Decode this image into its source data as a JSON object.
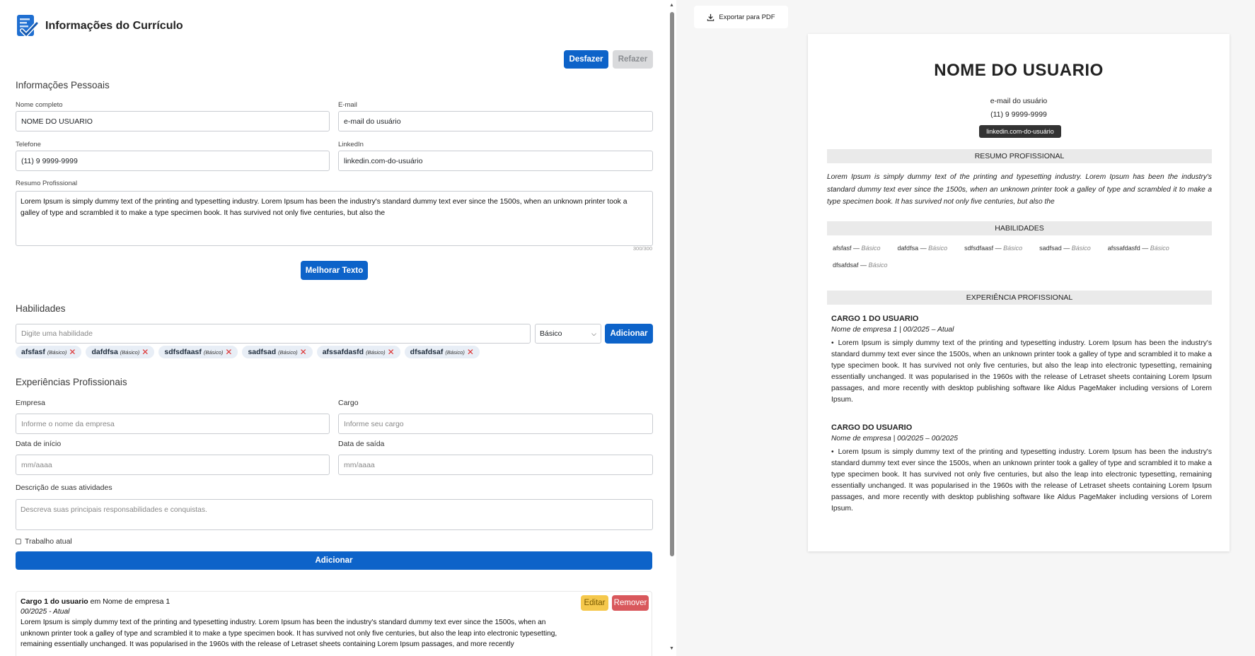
{
  "editor": {
    "title": "Informações do Currículo",
    "undo_label": "Desfazer",
    "redo_label": "Refazer",
    "personal": {
      "section_title": "Informações Pessoais",
      "name_label": "Nome completo",
      "name_value": "NOME DO USUARIO",
      "email_label": "E-mail",
      "email_value": "e-mail do usuário",
      "phone_label": "Telefone",
      "phone_value": "(11) 9 9999-9999",
      "linkedin_label": "LinkedIn",
      "linkedin_value": "linkedin.com-do-usuário",
      "summary_label": "Resumo Profissional",
      "summary_value": "Lorem Ipsum is simply dummy text of the printing and typesetting industry. Lorem Ipsum has been the industry's standard dummy text ever since the 1500s, when an unknown printer took a galley of type and scrambled it to make a type specimen book. It has survived not only five centuries, but also the",
      "summary_counter": "300/300",
      "improve_label": "Melhorar Texto"
    },
    "skills": {
      "section_title": "Habilidades",
      "input_placeholder": "Digite uma habilidade",
      "level_selected": "Básico",
      "add_label": "Adicionar",
      "items": [
        {
          "name": "afsfasf",
          "level": "(Básico)"
        },
        {
          "name": "dafdfsa",
          "level": "(Básico)"
        },
        {
          "name": "sdfsdfaasf",
          "level": "(Básico)"
        },
        {
          "name": "sadfsad",
          "level": "(Básico)"
        },
        {
          "name": "afssafdasfd",
          "level": "(Básico)"
        },
        {
          "name": "dfsafdsaf",
          "level": "(Básico)"
        }
      ]
    },
    "experience": {
      "section_title": "Experiências Profissionais",
      "company_label": "Empresa",
      "company_placeholder": "Informe o nome da empresa",
      "role_label": "Cargo",
      "role_placeholder": "Informe seu cargo",
      "start_label": "Data de início",
      "start_placeholder": "mm/aaaa",
      "end_label": "Data de saída",
      "end_placeholder": "mm/aaaa",
      "desc_label": "Descrição de suas atividades",
      "desc_placeholder": "Descreva suas principais responsabilidades e conquistas.",
      "current_label": "Trabalho atual",
      "add_label": "Adicionar",
      "card": {
        "role": "Cargo 1 do usuario",
        "connector": "em",
        "company": "Nome de empresa 1",
        "dates": "00/2025 - Atual",
        "desc": "Lorem Ipsum is simply dummy text of the printing and typesetting industry. Lorem Ipsum has been the industry's standard dummy text ever since the 1500s, when an unknown printer took a galley of type and scrambled it to make a type specimen book. It has survived not only five centuries, but also the leap into electronic typesetting, remaining essentially unchanged. It was popularised in the 1960s with the release of Letraset sheets containing Lorem Ipsum passages, and more recently",
        "edit_label": "Editar",
        "remove_label": "Remover"
      }
    }
  },
  "preview": {
    "export_label": "Exportar para PDF",
    "name": "NOME DO USUARIO",
    "email": "e-mail do usuário",
    "phone": "(11) 9 9999-9999",
    "linkedin": "linkedin.com-do-usuário",
    "summary_title": "RESUMO PROFISSIONAL",
    "summary": "Lorem Ipsum is simply dummy text of the printing and typesetting industry. Lorem Ipsum has been the industry's standard dummy text ever since the 1500s, when an unknown printer took a galley of type and scrambled it to make a type specimen book. It has survived not only five centuries, but also the",
    "skills_title": "HABILIDADES",
    "skills": [
      {
        "name": "afsfasf",
        "level": "Básico"
      },
      {
        "name": "dafdfsa",
        "level": "Básico"
      },
      {
        "name": "sdfsdfaasf",
        "level": "Básico"
      },
      {
        "name": "sadfsad",
        "level": "Básico"
      },
      {
        "name": "afssafdasfd",
        "level": "Básico"
      },
      {
        "name": "dfsafdsaf",
        "level": "Básico"
      }
    ],
    "experience_title": "EXPERIÊNCIA PROFISSIONAL",
    "jobs": [
      {
        "title": "CARGO 1 DO USUARIO",
        "sub": "Nome de empresa 1 | 00/2025 – Atual",
        "desc": "Lorem Ipsum is simply dummy text of the printing and typesetting industry. Lorem Ipsum has been the industry's standard dummy text ever since the 1500s, when an unknown printer took a galley of type and scrambled it to make a type specimen book. It has survived not only five centuries, but also the leap into electronic typesetting, remaining essentially unchanged. It was popularised in the 1960s with the release of Letraset sheets containing Lorem Ipsum passages, and more recently with desktop publishing software like Aldus PageMaker including versions of Lorem Ipsum."
      },
      {
        "title": "CARGO DO USUARIO",
        "sub": "Nome de empresa | 00/2025 – 00/2025",
        "desc": "Lorem Ipsum is simply dummy text of the printing and typesetting industry. Lorem Ipsum has been the industry's standard dummy text ever since the 1500s, when an unknown printer took a galley of type and scrambled it to make a type specimen book. It has survived not only five centuries, but also the leap into electronic typesetting, remaining essentially unchanged. It was popularised in the 1960s with the release of Letraset sheets containing Lorem Ipsum passages, and more recently with desktop publishing software like Aldus PageMaker including versions of Lorem Ipsum."
      }
    ]
  },
  "icons": {
    "logo": "resume-check-icon",
    "export": "download-icon",
    "skill_remove": "close-icon",
    "select": "chevron-down-icon"
  },
  "colors": {
    "primary": "#0d63c9",
    "edit": "#f5c84c",
    "remove": "#d9585c",
    "preview_bg": "#f6f6f6"
  }
}
